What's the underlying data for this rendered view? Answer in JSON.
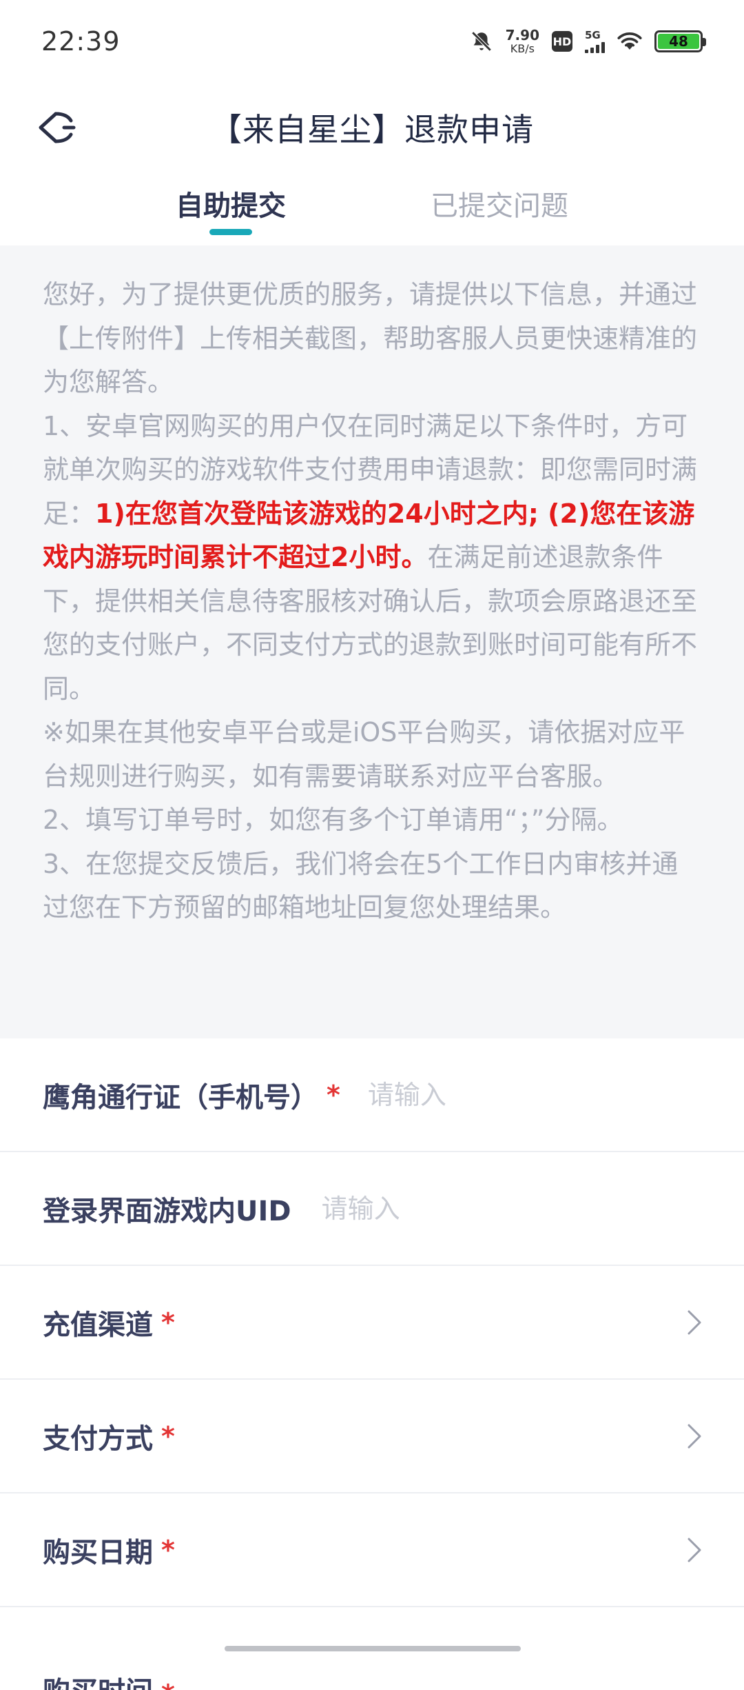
{
  "status_bar": {
    "time": "22:39",
    "net_speed_value": "7.90",
    "net_speed_unit": "KB/s",
    "hd_label": "HD",
    "signal_label": "5G",
    "battery_level": "48",
    "battery_color": "#3bc53f"
  },
  "header": {
    "title": "【来自星尘】退款申请",
    "back_icon": "back-arrow-icon"
  },
  "tabs": [
    {
      "label": "自助提交",
      "active": true
    },
    {
      "label": "已提交问题",
      "active": false
    }
  ],
  "notice": {
    "intro": "您好，为了提供更优质的服务，请提供以下信息，并通过【上传附件】上传相关截图，帮助客服人员更快速精准的为您解答。",
    "rule1_prefix": "1、安卓官网购买的用户仅在同时满足以下条件时，方可就单次购买的游戏软件支付费用申请退款：即您需同时满足：",
    "rule1_highlight": "1)在您首次登陆该游戏的24小时之内; (2)您在该游戏内游玩时间累计不超过2小时。",
    "rule1_suffix": "在满足前述退款条件下，提供相关信息待客服核对确认后，款项会原路退还至您的支付账户，不同支付方式的退款到账时间可能有所不同。",
    "other_platform": "※如果在其他安卓平台或是iOS平台购买，请依据对应平台规则进行购买，如有需要请联系对应平台客服。",
    "rule2": "2、填写订单号时，如您有多个订单请用“；”分隔。",
    "rule3": "3、在您提交反馈后，我们将会在5个工作日内审核并通过您在下方预留的邮箱地址回复您处理结果。",
    "highlight_color": "#e31b1b"
  },
  "form": {
    "required_mark": "*",
    "input_placeholder": "请输入",
    "fields": [
      {
        "label": "鹰角通行证（手机号）",
        "required": true,
        "type": "text"
      },
      {
        "label": "登录界面游戏内UID",
        "required": false,
        "type": "text"
      },
      {
        "label": "充值渠道",
        "required": true,
        "type": "select"
      },
      {
        "label": "支付方式",
        "required": true,
        "type": "select"
      },
      {
        "label": "购买日期",
        "required": true,
        "type": "select"
      },
      {
        "label": "购买时间",
        "required": true,
        "type": "select"
      }
    ]
  },
  "colors": {
    "accent": "#19a8b8",
    "required": "#e33535"
  }
}
